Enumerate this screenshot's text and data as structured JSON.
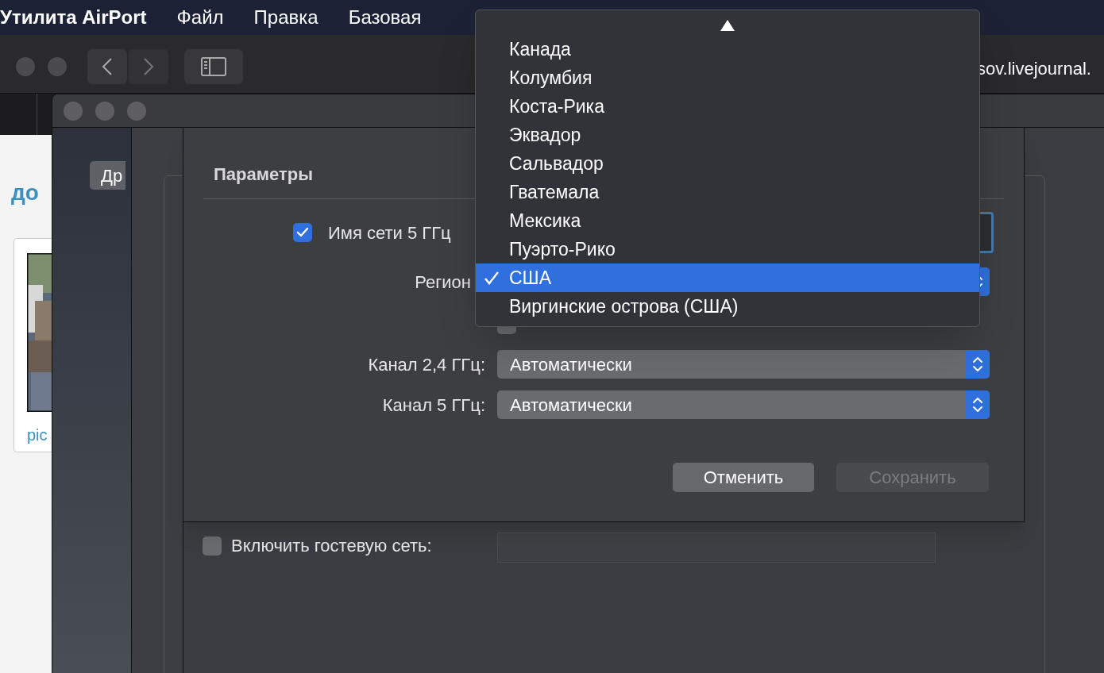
{
  "menu_bar": {
    "app": "Утилита AirPort",
    "items": [
      "Файл",
      "Правка",
      "Базовая"
    ]
  },
  "browser": {
    "url": "sov.livejournal.",
    "page_heading": "до",
    "card_caption": "pic"
  },
  "airport_window": {
    "sidebar_button": "Др",
    "guest_network": {
      "label": "Включить гостевую сеть:",
      "checked": false
    }
  },
  "sheet": {
    "title": "Параметры",
    "network_name": {
      "label": "Имя сети 5 ГГц",
      "checked": true
    },
    "region": {
      "label": "Регион"
    },
    "hidden_network": {
      "checked": false
    },
    "channels": [
      {
        "label": "Канал 2,4 ГГц:",
        "value": "Автоматически"
      },
      {
        "label": "Канал 5 ГГц:",
        "value": "Автоматически"
      }
    ],
    "buttons": [
      {
        "label": "Отменить",
        "disabled": false
      },
      {
        "label": "Сохранить",
        "disabled": true
      }
    ]
  },
  "region_menu": {
    "items": [
      {
        "label": "Канада",
        "selected": false
      },
      {
        "label": "Колумбия",
        "selected": false
      },
      {
        "label": "Коста-Рика",
        "selected": false
      },
      {
        "label": "Эквадор",
        "selected": false
      },
      {
        "label": "Сальвадор",
        "selected": false
      },
      {
        "label": "Гватемала",
        "selected": false
      },
      {
        "label": "Мексика",
        "selected": false
      },
      {
        "label": "Пуэрто-Рико",
        "selected": false
      },
      {
        "label": "США",
        "selected": true
      },
      {
        "label": "Виргинские острова (США)",
        "selected": false
      }
    ]
  }
}
